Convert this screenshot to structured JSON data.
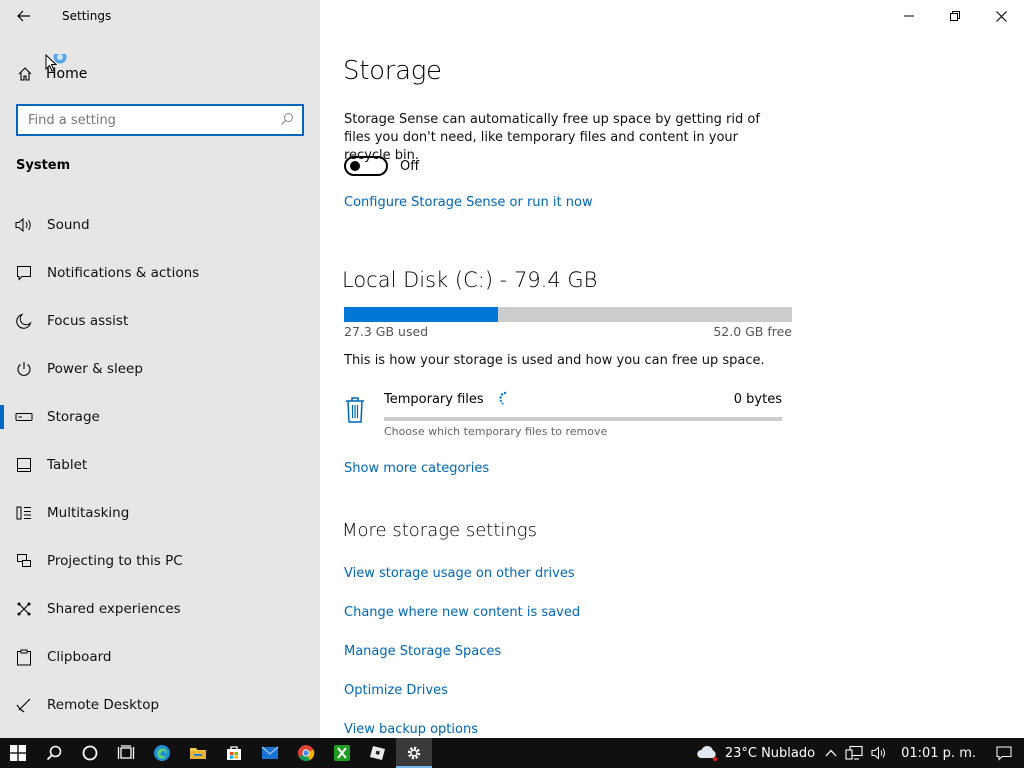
{
  "window": {
    "app_title": "Settings",
    "minimize": "minimize",
    "maximize": "maximize",
    "close": "close"
  },
  "sidebar": {
    "home_label": "Home",
    "search_placeholder": "Find a setting",
    "section": "System",
    "items": [
      {
        "label": "Sound",
        "icon": "speaker-icon"
      },
      {
        "label": "Notifications & actions",
        "icon": "notification-icon"
      },
      {
        "label": "Focus assist",
        "icon": "moon-icon"
      },
      {
        "label": "Power & sleep",
        "icon": "power-icon"
      },
      {
        "label": "Storage",
        "icon": "storage-drive-icon",
        "active": true
      },
      {
        "label": "Tablet",
        "icon": "tablet-icon"
      },
      {
        "label": "Multitasking",
        "icon": "multitasking-icon"
      },
      {
        "label": "Projecting to this PC",
        "icon": "projecting-icon"
      },
      {
        "label": "Shared experiences",
        "icon": "shared-experiences-icon"
      },
      {
        "label": "Clipboard",
        "icon": "clipboard-icon"
      },
      {
        "label": "Remote Desktop",
        "icon": "remote-desktop-icon"
      }
    ]
  },
  "main": {
    "title": "Storage",
    "description": "Storage Sense can automatically free up space by getting rid of files you don't need, like temporary files and content in your recycle bin.",
    "toggle_state": "Off",
    "configure_link": "Configure Storage Sense or run it now",
    "disk": {
      "title": "Local Disk (C:) - 79.4 GB",
      "used": "27.3 GB used",
      "free": "52.0 GB free",
      "used_fraction": 0.344
    },
    "info": "This is how your storage is used and how you can free up space.",
    "category": {
      "name": "Temporary files",
      "size": "0 bytes",
      "subtitle": "Choose which temporary files to remove"
    },
    "show_more_link": "Show more categories",
    "more_title": "More storage settings",
    "more_links": [
      "View storage usage on other drives",
      "Change where new content is saved",
      "Manage Storage Spaces",
      "Optimize Drives",
      "View backup options"
    ]
  },
  "taskbar": {
    "apps": [
      "windows-start-icon",
      "search-icon",
      "cortana-icon",
      "task-view-icon",
      "edge-icon",
      "file-explorer-icon",
      "store-icon",
      "mail-icon",
      "chrome-icon",
      "xbox-icon",
      "roblox-icon",
      "settings-gear-icon"
    ],
    "weather": "23°C  Nublado",
    "time": "01:01 p. m."
  },
  "colors": {
    "accent": "#0067c0",
    "link": "#0067b8",
    "bar_fill": "#0078d7",
    "sidebar_bg": "#e6e6e6",
    "taskbar_bg": "#101010"
  }
}
